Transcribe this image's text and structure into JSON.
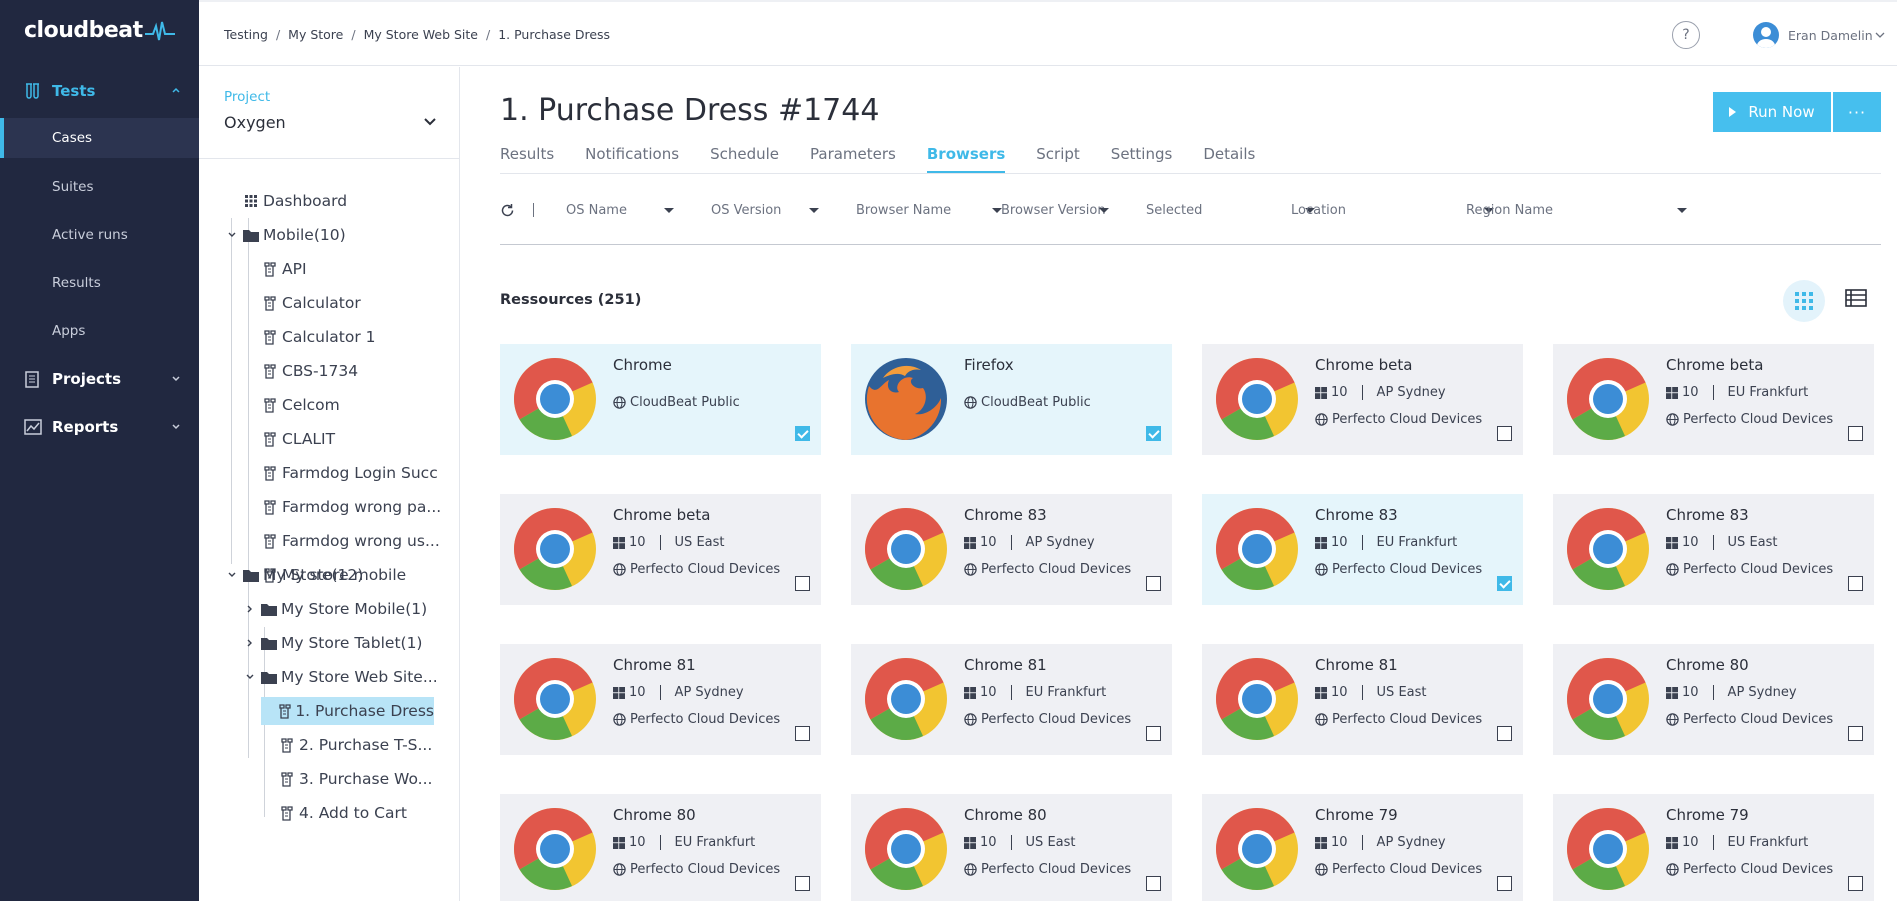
{
  "nav": {
    "logo": "cloudbeat",
    "sections": {
      "tests": "Tests",
      "projects": "Projects",
      "reports": "Reports"
    },
    "items": {
      "cases": "Cases",
      "suites": "Suites",
      "active_runs": "Active runs",
      "results": "Results",
      "apps": "Apps"
    }
  },
  "topbar": {
    "breadcrumb": [
      "Testing",
      "My Store",
      "My Store Web Site",
      "1. Purchase Dress"
    ],
    "help": "?",
    "user": "Eran Damelin"
  },
  "project": {
    "label": "Project",
    "value": "Oxygen"
  },
  "tree": {
    "dashboard": "Dashboard",
    "mobile": "Mobile(10)",
    "mobile_items": [
      "API",
      "Calculator",
      "Calculator 1",
      "CBS-1734",
      "Celcom",
      "CLALIT",
      "Farmdog Login Succ",
      "Farmdog wrong pa...",
      "Farmdog wrong us...",
      "My store mobile"
    ],
    "my_store": "My Store(12)",
    "my_store_mobile": "My Store Mobile(1)",
    "my_store_tablet": "My Store Tablet(1)",
    "my_store_web": "My Store Web Site...",
    "web_items": [
      "1. Purchase Dress",
      "2. Purchase T-S...",
      "3. Purchase Wo...",
      "4. Add to Cart"
    ]
  },
  "main": {
    "title": "1. Purchase Dress #1744",
    "run_now": "Run Now",
    "more": "···",
    "tabs": [
      "Results",
      "Notifications",
      "Schedule",
      "Parameters",
      "Browsers",
      "Script",
      "Settings",
      "Details"
    ],
    "active_tab": "Browsers",
    "filters": [
      "OS Name",
      "OS Version",
      "Browser Name",
      "Browser Version",
      "Selected",
      "Location",
      "Region Name"
    ],
    "resources_title": "Ressources (251)"
  },
  "cards": [
    {
      "name": "Chrome",
      "provider": "CloudBeat Public",
      "selected": true,
      "browser": "chrome"
    },
    {
      "name": "Firefox",
      "provider": "CloudBeat Public",
      "selected": true,
      "browser": "firefox"
    },
    {
      "name": "Chrome beta",
      "os": "10",
      "region": "AP Sydney",
      "provider": "Perfecto Cloud Devices",
      "selected": false,
      "browser": "chrome"
    },
    {
      "name": "Chrome beta",
      "os": "10",
      "region": "EU Frankfurt",
      "provider": "Perfecto Cloud Devices",
      "selected": false,
      "browser": "chrome"
    },
    {
      "name": "Chrome beta",
      "os": "10",
      "region": "US East",
      "provider": "Perfecto Cloud Devices",
      "selected": false,
      "browser": "chrome"
    },
    {
      "name": "Chrome 83",
      "os": "10",
      "region": "AP Sydney",
      "provider": "Perfecto Cloud Devices",
      "selected": false,
      "browser": "chrome"
    },
    {
      "name": "Chrome 83",
      "os": "10",
      "region": "EU Frankfurt",
      "provider": "Perfecto Cloud Devices",
      "selected": true,
      "browser": "chrome"
    },
    {
      "name": "Chrome 83",
      "os": "10",
      "region": "US East",
      "provider": "Perfecto Cloud Devices",
      "selected": false,
      "browser": "chrome"
    },
    {
      "name": "Chrome 81",
      "os": "10",
      "region": "AP Sydney",
      "provider": "Perfecto Cloud Devices",
      "selected": false,
      "browser": "chrome"
    },
    {
      "name": "Chrome 81",
      "os": "10",
      "region": "EU Frankfurt",
      "provider": "Perfecto Cloud Devices",
      "selected": false,
      "browser": "chrome"
    },
    {
      "name": "Chrome 81",
      "os": "10",
      "region": "US East",
      "provider": "Perfecto Cloud Devices",
      "selected": false,
      "browser": "chrome"
    },
    {
      "name": "Chrome 80",
      "os": "10",
      "region": "AP Sydney",
      "provider": "Perfecto Cloud Devices",
      "selected": false,
      "browser": "chrome"
    },
    {
      "name": "Chrome 80",
      "os": "10",
      "region": "EU Frankfurt",
      "provider": "Perfecto Cloud Devices",
      "selected": false,
      "browser": "chrome"
    },
    {
      "name": "Chrome 80",
      "os": "10",
      "region": "US East",
      "provider": "Perfecto Cloud Devices",
      "selected": false,
      "browser": "chrome"
    },
    {
      "name": "Chrome 79",
      "os": "10",
      "region": "AP Sydney",
      "provider": "Perfecto Cloud Devices",
      "selected": false,
      "browser": "chrome"
    },
    {
      "name": "Chrome 79",
      "os": "10",
      "region": "EU Frankfurt",
      "provider": "Perfecto Cloud Devices",
      "selected": false,
      "browser": "chrome"
    }
  ],
  "colors": {
    "accent": "#3fb9e8",
    "nav_bg": "#212840",
    "button": "#46bfee"
  }
}
